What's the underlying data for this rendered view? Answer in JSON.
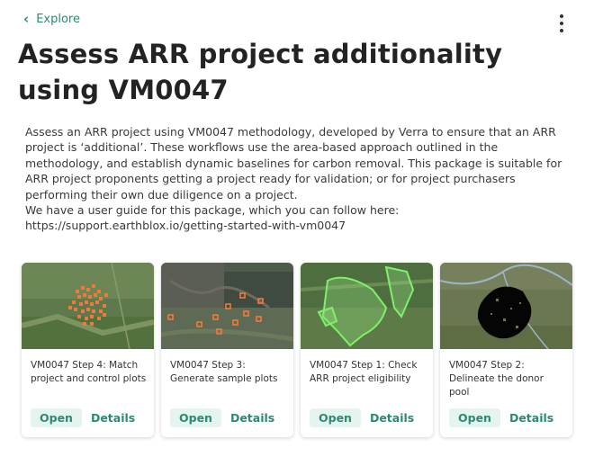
{
  "nav": {
    "back_label": "Explore"
  },
  "page": {
    "title": "Assess ARR project additionality using VM0047",
    "description_lines": [
      "Assess an ARR project using VM0047 methodology, developed by Verra to ensure that an ARR",
      "project is ‘additional’. These workflows use the area-based approach outlined in the",
      "methodology, and establish dynamic baselines for carbon removal. This package is suitable for",
      "ARR project proponents getting a project ready for validation; or for project purchasers",
      "performing their own due diligence on a project.",
      "We have a user guide for this package, which you can follow here:",
      "https://support.earthblox.io/getting-started-with-vm0047"
    ]
  },
  "cards": [
    {
      "title": "VM0047 Step 4: Match project and control plots",
      "open_label": "Open",
      "details_label": "Details"
    },
    {
      "title": "VM0047 Step 3: Generate sample plots",
      "open_label": "Open",
      "details_label": "Details"
    },
    {
      "title": "VM0047 Step 1: Check ARR project eligibility",
      "open_label": "Open",
      "details_label": "Details"
    },
    {
      "title": "VM0047 Step 2: Delineate the donor pool",
      "open_label": "Open",
      "details_label": "Details"
    }
  ],
  "icons": {
    "back": "chevron-left-icon",
    "menu": "kebab-menu-icon"
  },
  "colors": {
    "accent": "#2b8a73",
    "accent_bg": "#e6f4ef"
  }
}
